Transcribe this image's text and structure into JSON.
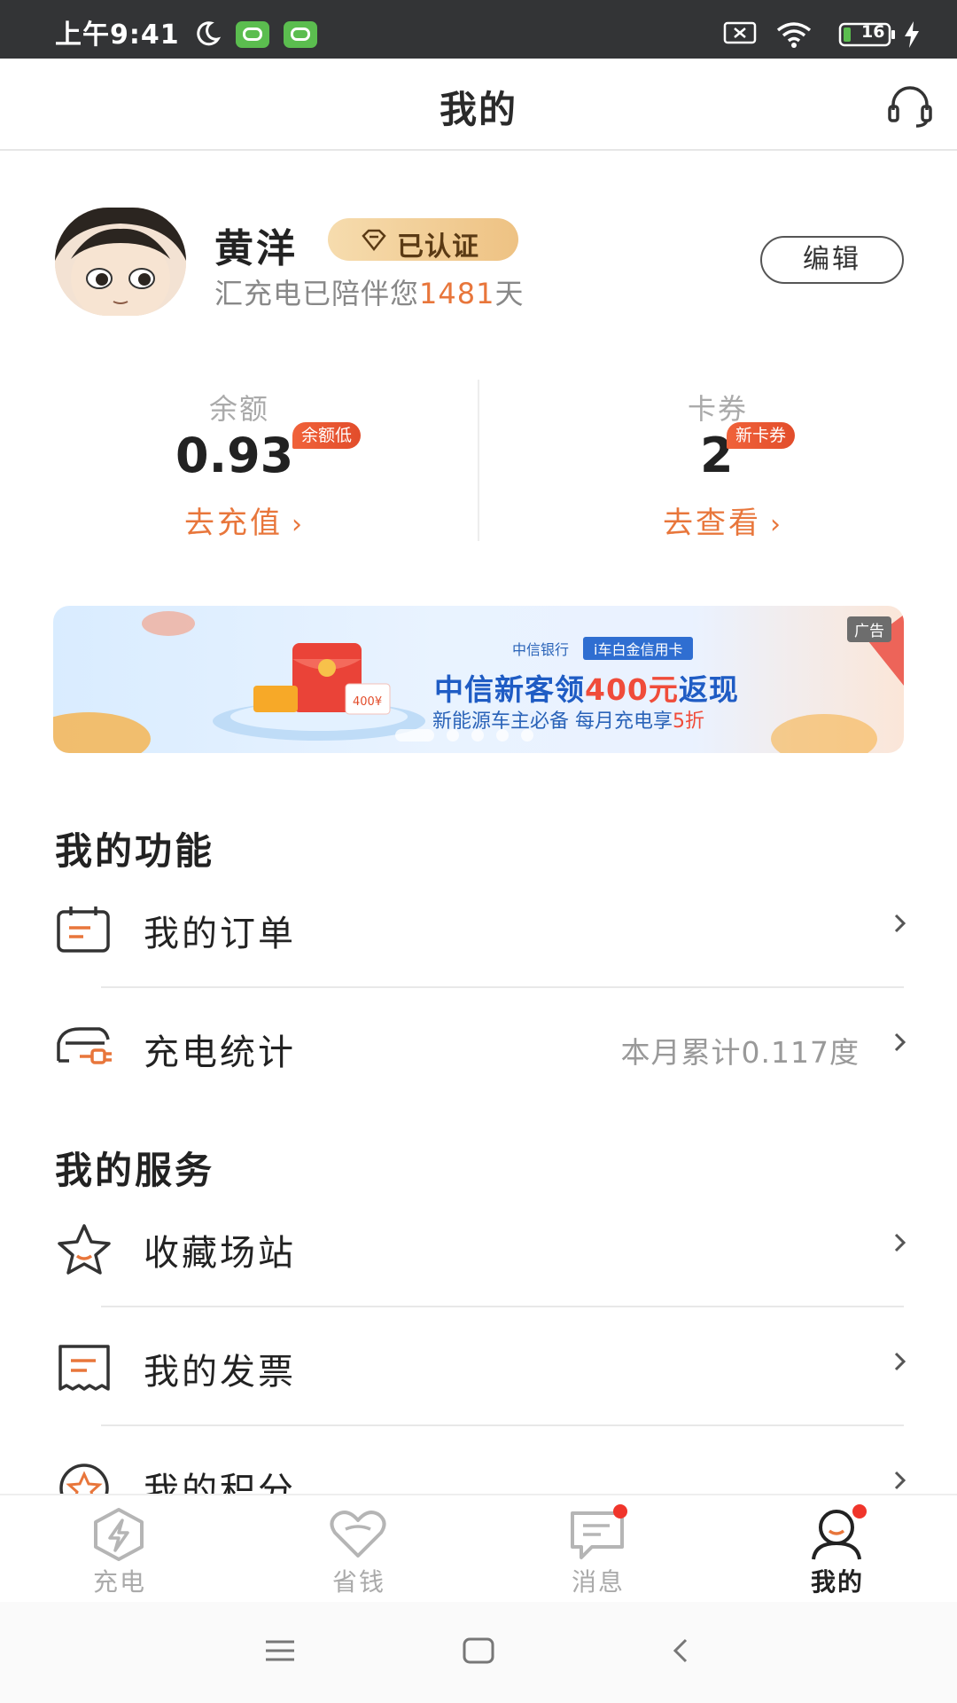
{
  "status_bar": {
    "time": "上午9:41",
    "battery": "16"
  },
  "header": {
    "title": "我的",
    "customer_service_icon": "headset-icon"
  },
  "profile": {
    "name": "黄洋",
    "verified_label": "已认证",
    "companion_prefix": "汇充电已陪伴您",
    "companion_days": "1481",
    "companion_suffix": "天",
    "edit_label": "编辑"
  },
  "stats": {
    "balance": {
      "label": "余额",
      "value": "0.93",
      "badge": "余额低",
      "link": "去充值"
    },
    "coupons": {
      "label": "卡券",
      "value": "2",
      "badge": "新卡券",
      "link": "去查看"
    }
  },
  "banner": {
    "ad_label": "广告",
    "bank": "中信银行",
    "card": "i车白金信用卡",
    "main_prefix": "中信新客领",
    "main_highlight": "400元",
    "main_suffix": "返现",
    "sub_prefix": "新能源车主必备  每月充电享",
    "sub_highlight": "5折"
  },
  "functions": {
    "title": "我的功能",
    "items": [
      {
        "label": "我的订单",
        "icon": "order-icon",
        "extra": ""
      },
      {
        "label": "充电统计",
        "icon": "charging-stats-icon",
        "extra": "本月累计0.117度"
      }
    ]
  },
  "services": {
    "title": "我的服务",
    "items": [
      {
        "label": "收藏场站",
        "icon": "star-icon"
      },
      {
        "label": "我的发票",
        "icon": "invoice-icon"
      },
      {
        "label": "我的积分",
        "icon": "points-icon"
      }
    ]
  },
  "tabbar": {
    "tabs": [
      {
        "label": "充电",
        "icon": "lightning-icon",
        "active": false
      },
      {
        "label": "省钱",
        "icon": "heart-icon",
        "active": false
      },
      {
        "label": "消息",
        "icon": "message-icon",
        "active": false
      },
      {
        "label": "我的",
        "icon": "user-icon",
        "active": true
      }
    ]
  },
  "colors": {
    "accent": "#e8763b",
    "badge": "#e24d2b",
    "verify_gold": "#eec283"
  }
}
